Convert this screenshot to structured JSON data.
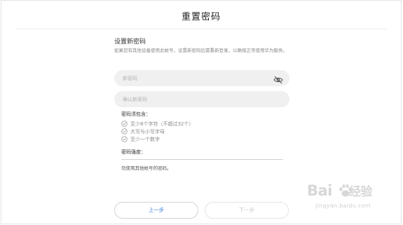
{
  "page": {
    "title": "重置密码"
  },
  "form": {
    "section_heading": "设置新密码",
    "description": "如果您有其他设备使用此帐号，设置新密码后需重新登录，以确保正常使用华为服务。",
    "new_password_placeholder": "新密码",
    "confirm_password_placeholder": "确认新密码",
    "visibility_icon": "eye-off-icon"
  },
  "requirements": {
    "heading": "密码须包含：",
    "items": [
      "至少8个字符（不超过32个）",
      "大写与小写字母",
      "至少一个数字"
    ],
    "check_icon": "check-circle-icon"
  },
  "strength": {
    "label": "密码强度："
  },
  "warning": "勿使用其他帐号的密码。",
  "buttons": {
    "prev_label": "上一步",
    "next_label": "下一步"
  },
  "watermark": {
    "brand_left": "Bai",
    "brand_right": "经验",
    "url": "jingyan.baidu.com"
  },
  "colors": {
    "link_blue": "#3a7fd8",
    "input_bg": "#f0f0f0",
    "disabled_text": "#c8c8c8"
  }
}
